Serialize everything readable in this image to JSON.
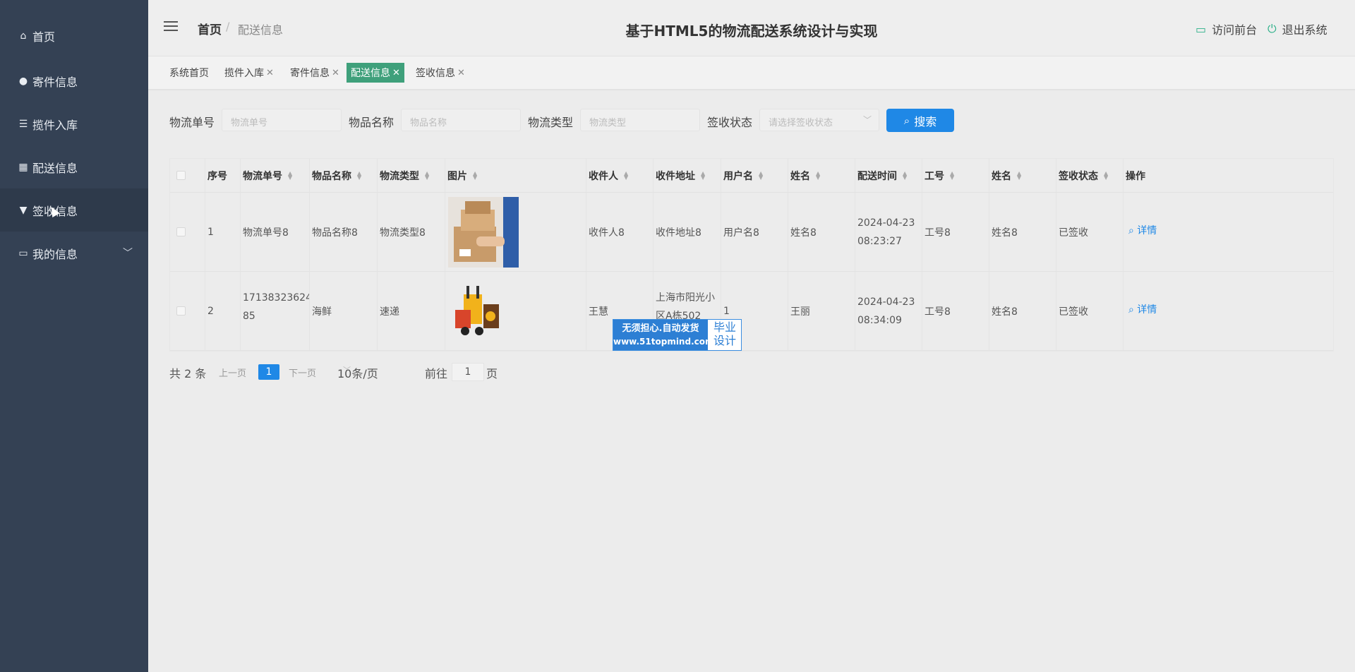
{
  "sidebar": {
    "items": [
      {
        "label": "首页",
        "icon": "home-icon"
      },
      {
        "label": "寄件信息",
        "icon": "user-icon"
      },
      {
        "label": "揽件入库",
        "icon": "sliders-icon"
      },
      {
        "label": "配送信息",
        "icon": "grid-icon"
      },
      {
        "label": "签收信息",
        "icon": "stamp-icon"
      },
      {
        "label": "我的信息",
        "icon": "card-icon"
      }
    ]
  },
  "header": {
    "breadcrumb_home": "首页",
    "breadcrumb_sep": "/",
    "breadcrumb_current": "配送信息",
    "title": "基于HTML5的物流配送系统设计与实现",
    "visit_front": "访问前台",
    "logout": "退出系统"
  },
  "tabs": [
    {
      "label": "系统首页",
      "closable": false
    },
    {
      "label": "揽件入库",
      "closable": true
    },
    {
      "label": "寄件信息",
      "closable": true
    },
    {
      "label": "配送信息",
      "closable": true,
      "active": true
    },
    {
      "label": "签收信息",
      "closable": true
    }
  ],
  "close_glyph": "✕",
  "filters": {
    "tracking_label": "物流单号",
    "tracking_placeholder": "物流单号",
    "item_label": "物品名称",
    "item_placeholder": "物品名称",
    "type_label": "物流类型",
    "type_placeholder": "物流类型",
    "status_label": "签收状态",
    "status_placeholder": "请选择签收状态",
    "search": "搜索"
  },
  "table": {
    "columns": [
      "序号",
      "物流单号",
      "物品名称",
      "物流类型",
      "图片",
      "收件人",
      "收件地址",
      "用户名",
      "姓名",
      "配送时间",
      "工号",
      "姓名",
      "签收状态",
      "操作"
    ],
    "rows": [
      {
        "no": "1",
        "tracking": "物流单号8",
        "item": "物品名称8",
        "type": "物流类型8",
        "image": "delivery-person-with-boxes",
        "recipient": "收件人8",
        "address": "收件地址8",
        "username": "用户名8",
        "name": "姓名8",
        "time_date": "2024-04-23",
        "time_clock": "08:23:27",
        "staff_no": "工号8",
        "staff_name": "姓名8",
        "status": "已签收",
        "action": "详情"
      },
      {
        "no": "2",
        "tracking_a": "17138323624",
        "tracking_b": "85",
        "item": "海鲜",
        "type": "速递",
        "image": "forklift-with-parcels",
        "recipient": "王慧",
        "address_a": "上海市阳光小",
        "address_b": "区A栋502",
        "username": "1",
        "name": "王丽",
        "time_date": "2024-04-23",
        "time_clock": "08:34:09",
        "staff_no": "工号8",
        "staff_name": "姓名8",
        "status": "已签收",
        "action": "详情"
      }
    ]
  },
  "pager": {
    "total": "共 2 条",
    "prev": "上一页",
    "current": "1",
    "next": "下一页",
    "size": "10条/页",
    "goto": "前往",
    "goto_value": "1",
    "page_unit": "页"
  },
  "watermark": {
    "line1": "无须担心.自动发货",
    "line2": "www.51topmind.com",
    "right1": "毕业",
    "right2": "设计"
  },
  "colors": {
    "sidebar": "#344154",
    "accent": "#1f88e6",
    "active_tab": "#3fa07b",
    "header_icon": "#2fb18a"
  }
}
